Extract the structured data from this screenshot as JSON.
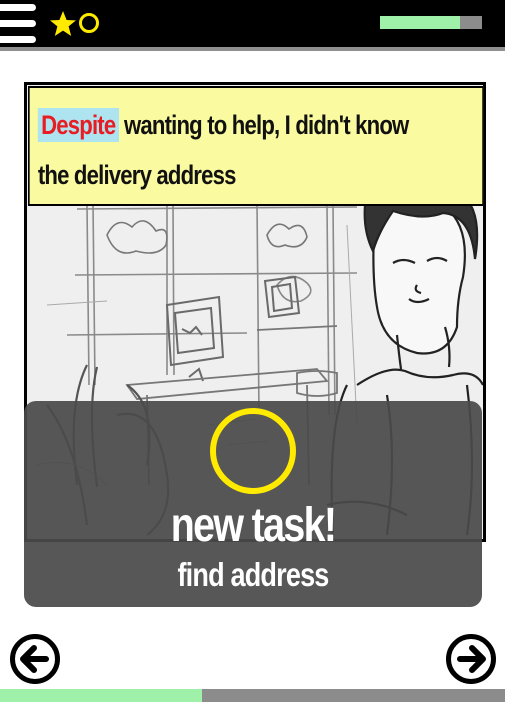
{
  "header": {
    "menu_icon": "hamburger-menu-icon",
    "star_icon": "star-icon",
    "circle_icon": "empty-circle-icon",
    "energy_level": 0.78,
    "energy_color": "#9ff0a8",
    "energy_track_color": "#8c8c8c",
    "star_color": "#ffea00"
  },
  "story": {
    "caption_highlight": "Despite",
    "caption_line1_rest": " wanting to help, I didn't know",
    "caption_line2": "the delivery address",
    "caption_bg": "#fafaa0",
    "highlight_bg": "#aee3f0",
    "highlight_color": "#e81d23"
  },
  "task": {
    "title": "new task!",
    "subtitle": "find address",
    "ring_color": "#ffea00"
  },
  "navigation": {
    "prev_icon": "arrow-left-icon",
    "next_icon": "arrow-right-icon"
  },
  "progress": {
    "fraction": 0.4,
    "fill_color": "#9ff0a8"
  }
}
